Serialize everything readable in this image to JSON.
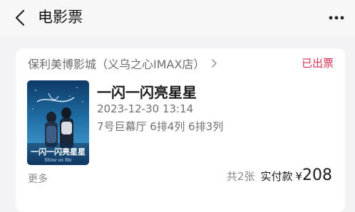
{
  "header": {
    "title": "电影票",
    "back_icon": "chevron-left-icon",
    "more_icon": "more-dots-icon"
  },
  "order": {
    "cinema": "保利美博影城（义乌之心IMAX店）",
    "status": "已出票",
    "status_color": "#d63355",
    "movie_title": "一闪一闪亮星星",
    "showtime": "2023-12-30 13:14",
    "seats": "7号巨幕厅 6排4列 6排3列",
    "more_label": "更多",
    "ticket_count": "共2张",
    "paid_label": "实付款",
    "currency": "¥",
    "amount": "208"
  },
  "poster": {
    "title_art": "一闪一闪亮星星",
    "script_art": "Shine on Me"
  }
}
